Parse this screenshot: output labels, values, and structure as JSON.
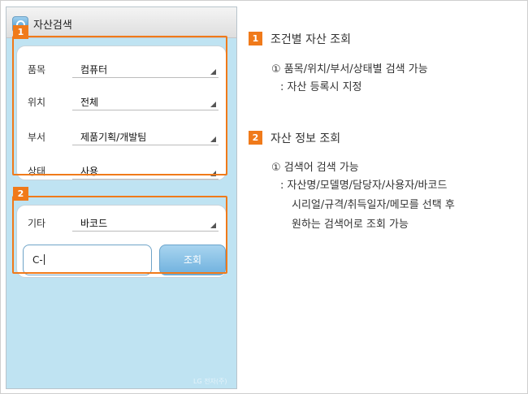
{
  "app": {
    "title": "자산검색",
    "watermark": "LG 전자(주)"
  },
  "panel1": {
    "marker": "1",
    "fields": [
      {
        "label": "품목",
        "value": "컴퓨터"
      },
      {
        "label": "위치",
        "value": "전체"
      },
      {
        "label": "부서",
        "value": "제품기획/개발팀"
      },
      {
        "label": "상태",
        "value": "사용"
      }
    ]
  },
  "panel2": {
    "marker": "2",
    "field": {
      "label": "기타",
      "value": "바코드"
    },
    "search_value": "C-",
    "search_button": "조회"
  },
  "description": {
    "sections": [
      {
        "number": "1",
        "title": "조건별 자산 조회",
        "lines": [
          "① 품목/위치/부서/상태별 검색 가능",
          ": 자산 등록시 지정"
        ]
      },
      {
        "number": "2",
        "title": "자산 정보 조회",
        "lines": [
          "① 검색어 검색 가능",
          ": 자산명/모델명/담당자/사용자/바코드",
          "시리얼/규격/취득일자/메모를 선택 후",
          "원하는 검색어로 조회 가능"
        ]
      }
    ]
  },
  "colors": {
    "accent_orange": "#f07a1a",
    "phone_background": "#bfe3f2",
    "button_blue": "#6fb1de"
  }
}
